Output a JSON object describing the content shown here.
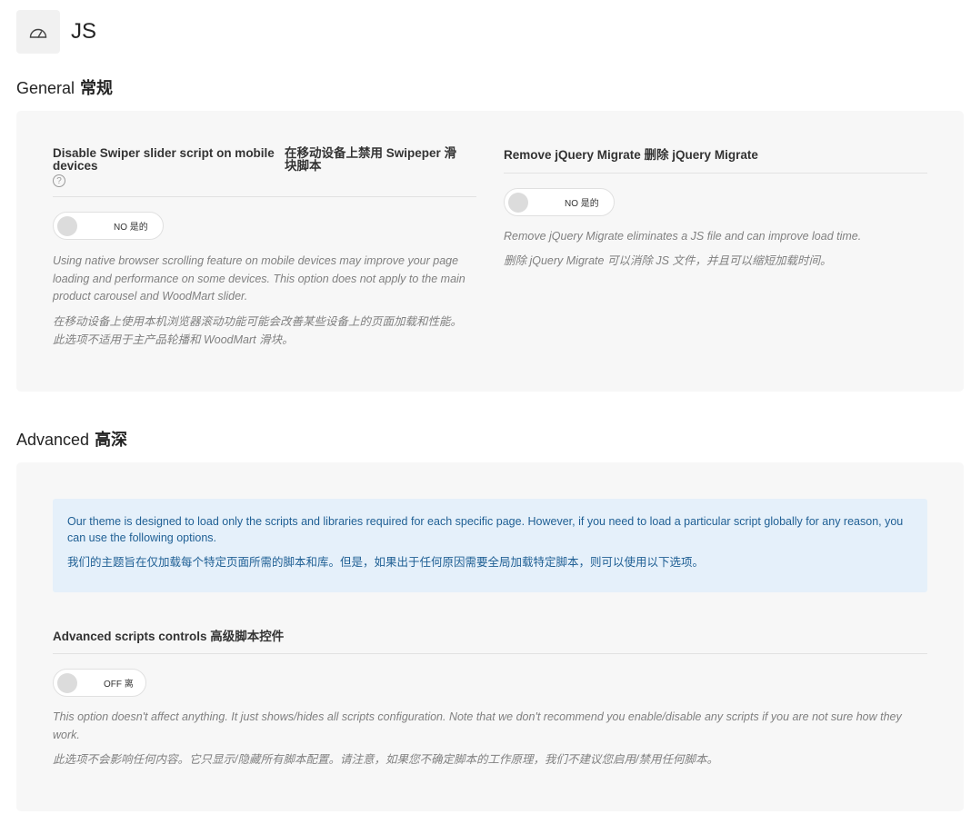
{
  "page": {
    "title": "JS",
    "icon": "speedometer-icon"
  },
  "general": {
    "title_en": "General",
    "title_cn": "常规",
    "swiper": {
      "label_en_1": "Disable Swiper slider script on mobile",
      "label_en_2": "devices",
      "label_cn_1": "在移动设备上禁用 Swipeper 滑",
      "label_cn_2": "块脚本",
      "help_icon": "?",
      "toggle_text": "NO  是的",
      "desc_en": "Using native browser scrolling feature on mobile devices may improve your page loading and performance on some devices. This option does not apply to the main product carousel and WoodMart slider.",
      "desc_cn": "在移动设备上使用本机浏览器滚动功能可能会改善某些设备上的页面加载和性能。此选项不适用于主产品轮播和 WoodMart 滑块。"
    },
    "migrate": {
      "label": "Remove jQuery Migrate  删除 jQuery Migrate",
      "toggle_text": "NO  是的",
      "desc_en": "Remove jQuery Migrate eliminates a JS file and can improve load time.",
      "desc_cn": "删除 jQuery Migrate 可以消除 JS 文件，并且可以缩短加载时间。"
    }
  },
  "advanced": {
    "title_en": "Advanced",
    "title_cn": "高深",
    "notice_en": "Our theme is designed to load only the scripts and libraries required for each specific page. However, if you need to load a particular script globally for any reason, you can use the following options.",
    "notice_cn": "我们的主题旨在仅加载每个特定页面所需的脚本和库。但是，如果出于任何原因需要全局加载特定脚本，则可以使用以下选项。",
    "controls": {
      "label": "Advanced scripts controls  高级脚本控件",
      "toggle_text": "OFF  离",
      "desc_en": "This option doesn't affect anything. It just shows/hides all scripts configuration. Note that we don't recommend you enable/disable any scripts if you are not sure how they work.",
      "desc_cn": "此选项不会影响任何内容。它只显示/隐藏所有脚本配置。请注意，如果您不确定脚本的工作原理，我们不建议您启用/禁用任何脚本。"
    }
  }
}
